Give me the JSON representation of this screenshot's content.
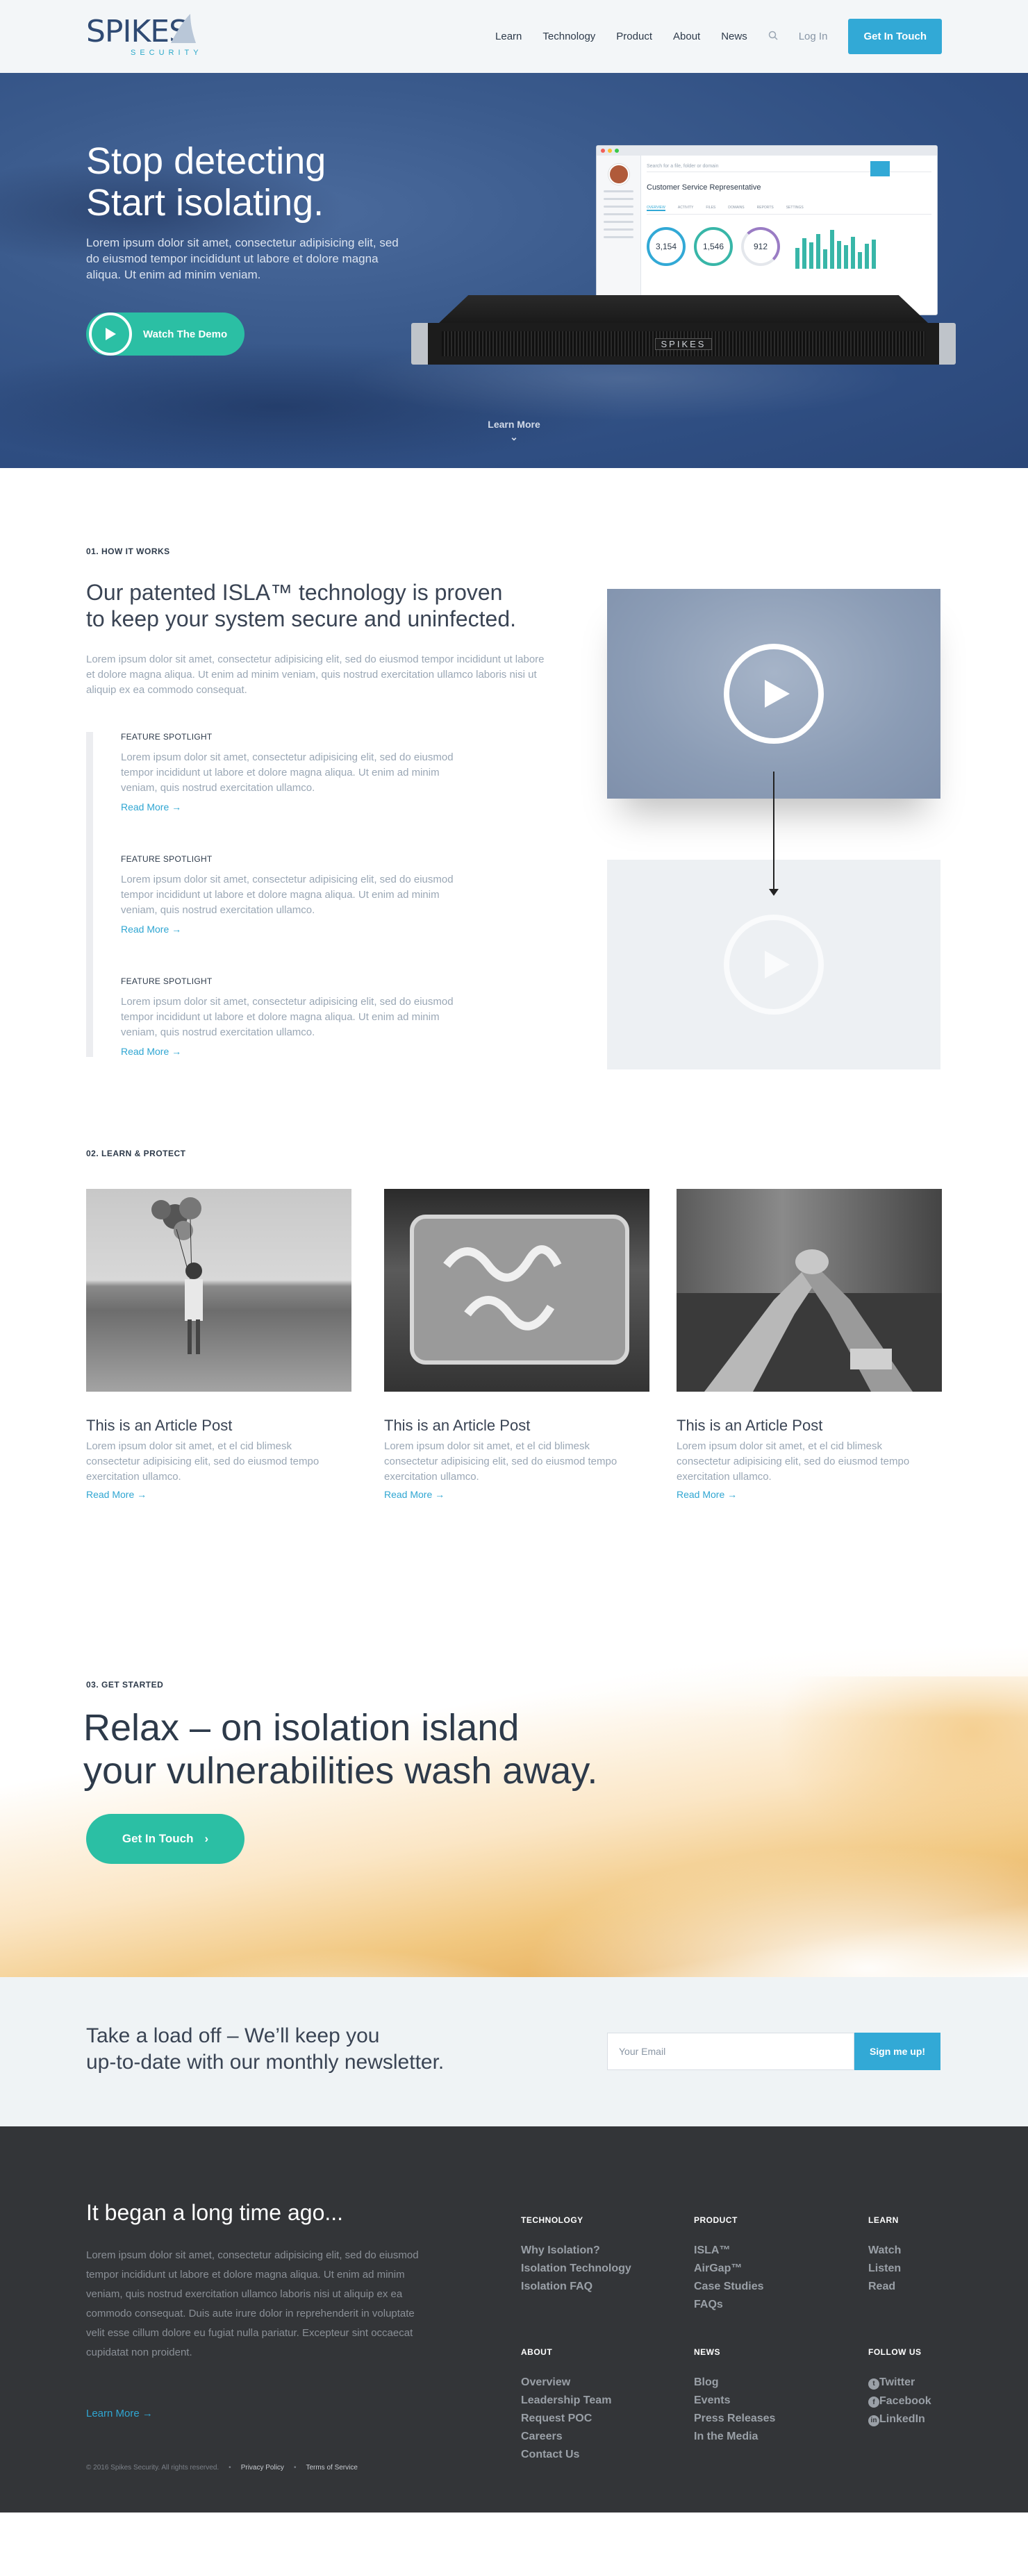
{
  "header": {
    "logo_word": "SPIKES",
    "logo_sub": "SECURITY",
    "nav": [
      "Learn",
      "Technology",
      "Product",
      "About",
      "News"
    ],
    "login": "Log In",
    "cta": "Get In Touch"
  },
  "hero": {
    "title_line1": "Stop detecting",
    "title_line2": "Start isolating.",
    "subtitle": "Lorem ipsum dolor sit amet, consectetur adipisicing elit, sed do eiusmod tempor incididunt ut labore et dolore magna aliqua. Ut enim ad minim veniam.",
    "demo_label": "Watch The Demo",
    "learn_more": "Learn More",
    "mockup": {
      "search_placeholder": "Search for a file, folder or domain",
      "page_title": "Customer Service Representative",
      "stats": [
        "3,154",
        "1,546",
        "912"
      ],
      "server_label": "SPIKES"
    }
  },
  "how": {
    "label": "01. HOW IT WORKS",
    "title_line1": "Our patented ISLA™ technology is proven",
    "title_line2": "to keep your system secure and uninfected.",
    "body": "Lorem ipsum dolor sit amet, consectetur adipisicing elit, sed do eiusmod tempor incididunt ut labore et dolore magna aliqua. Ut enim ad minim veniam, quis nostrud exercitation ullamco laboris nisi ut aliquip ex ea commodo consequat.",
    "features": [
      {
        "heading": "FEATURE SPOTLIGHT",
        "text": "Lorem ipsum dolor sit amet, consectetur adipisicing elit, sed do eiusmod tempor incididunt ut labore et dolore magna aliqua. Ut enim ad minim veniam, quis nostrud exercitation ullamco.",
        "link": "Read More →"
      },
      {
        "heading": "FEATURE SPOTLIGHT",
        "text": "Lorem ipsum dolor sit amet, consectetur adipisicing elit, sed do eiusmod tempor incididunt ut labore et dolore magna aliqua. Ut enim ad minim veniam, quis nostrud exercitation ullamco.",
        "link": "Read More →"
      },
      {
        "heading": "FEATURE SPOTLIGHT",
        "text": "Lorem ipsum dolor sit amet, consectetur adipisicing elit, sed do eiusmod tempor incididunt ut labore et dolore magna aliqua. Ut enim ad minim veniam, quis nostrud exercitation ullamco.",
        "link": "Read More →"
      }
    ]
  },
  "learn": {
    "label": "02. LEARN & PROTECT",
    "articles": [
      {
        "title": "This is an Article Post",
        "text": "Lorem ipsum dolor sit amet, et el cid blimesk consectetur adipisicing elit, sed do eiusmod tempo exercitation ullamco.",
        "link": "Read More →"
      },
      {
        "title": "This is an Article Post",
        "text": "Lorem ipsum dolor sit amet, et el cid blimesk consectetur adipisicing elit, sed do eiusmod tempo exercitation ullamco.",
        "link": "Read More →"
      },
      {
        "title": "This is an Article Post",
        "text": "Lorem ipsum dolor sit amet, et el cid blimesk consectetur adipisicing elit, sed do eiusmod tempo exercitation ullamco.",
        "link": "Read More →"
      }
    ]
  },
  "start": {
    "label": "03. GET STARTED",
    "title_line1": "Relax – on isolation island",
    "title_line2": "your vulnerabilities wash away.",
    "button": "Get In Touch"
  },
  "newsletter": {
    "title_line1": "Take a load off – We’ll keep you",
    "title_line2": "up-to-date with our monthly newsletter.",
    "placeholder": "Your Email",
    "button": "Sign me up!"
  },
  "footer": {
    "title": "It began a long time ago...",
    "body": "Lorem ipsum dolor sit amet, consectetur adipisicing elit, sed do eiusmod tempor incididunt ut labore et dolore magna aliqua. Ut enim ad minim veniam, quis nostrud exercitation ullamco laboris nisi ut aliquip ex ea commodo consequat. Duis aute irure dolor in reprehenderit in voluptate velit esse cillum dolore eu fugiat nulla pariatur. Excepteur sint occaecat cupidatat non proident.",
    "more": "Learn More →",
    "legal": {
      "copyright": "© 2016 Spikes Security. All rights reserved.",
      "privacy": "Privacy Policy",
      "terms": "Terms of Service"
    },
    "columns": {
      "technology": {
        "heading": "TECHNOLOGY",
        "links": [
          "Why Isolation?",
          "Isolation Technology",
          "Isolation FAQ"
        ]
      },
      "product": {
        "heading": "PRODUCT",
        "links": [
          "ISLA™",
          "AirGap™",
          "Case Studies",
          "FAQs"
        ]
      },
      "learn": {
        "heading": "LEARN",
        "links": [
          "Watch",
          "Listen",
          "Read"
        ]
      },
      "about": {
        "heading": "ABOUT",
        "links": [
          "Overview",
          "Leadership Team",
          "Request POC",
          "Careers",
          "Contact Us"
        ]
      },
      "news": {
        "heading": "NEWS",
        "links": [
          "Blog",
          "Events",
          "Press Releases",
          "In the Media"
        ]
      },
      "follow": {
        "heading": "FOLLOW US",
        "links": [
          "Twitter",
          "Facebook",
          "LinkedIn"
        ]
      }
    }
  },
  "colors": {
    "accent_blue": "#32a9d6",
    "accent_teal": "#2bbfa4",
    "footer_bg": "#333538",
    "hero_bg": "#3a5a8c"
  }
}
